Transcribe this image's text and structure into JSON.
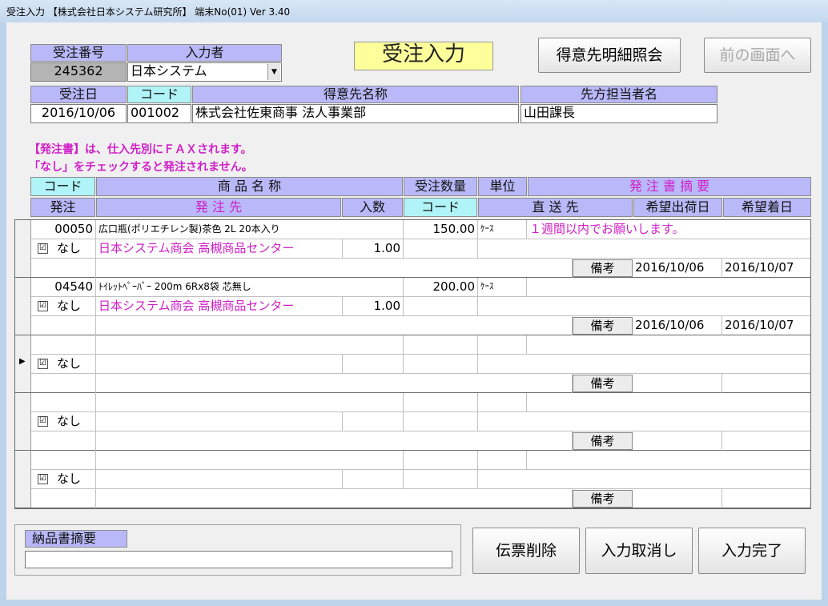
{
  "window": {
    "title": "受注入力 【株式会社日本システム研究所】 端末No(01)  Ver 3.40"
  },
  "header": {
    "order_no_label": "受注番号",
    "order_no": "245362",
    "inputter_label": "入力者",
    "inputter": "日本システム",
    "screen_title": "受注入力",
    "customer_detail_button": "得意先明細照会",
    "prev_screen_button": "前の画面へ",
    "order_date_label": "受注日",
    "order_date": "2016/10/06",
    "code_label": "コード",
    "customer_code": "001002",
    "customer_name_label": "得意先名称",
    "customer_name": "株式会社佐東商事 法人事業部",
    "contact_label": "先方担当者名",
    "contact": "山田課長"
  },
  "notes": {
    "line1": "【発注書】は、仕入先別にＦＡＸされます。",
    "line2": "「なし」をチェックすると発注されません。"
  },
  "grid_headers": {
    "code": "コード",
    "product_name": "商 品 名 称",
    "order_qty": "受注数量",
    "unit": "単位",
    "po_summary": "発 注 書 摘 要",
    "order": "発注",
    "supplier": "発 注 先",
    "pack_qty": "入数",
    "code2": "コード",
    "direct_ship": "直 送 先",
    "ship_date": "希望出荷日",
    "arrival_date": "希望着日"
  },
  "rows": [
    {
      "code": "00050",
      "product": "広口瓶(ポリエチレン製)茶色 2L 20本入り",
      "qty": "150.00",
      "unit": "ｹｰｽ",
      "summary": "１週間以内でお願いします。",
      "nashi": "なし",
      "supplier": "日本システム商会 高槻商品センター",
      "pack": "1.00",
      "remarks": "備考",
      "ship_date": "2016/10/06",
      "arrival_date": "2016/10/07"
    },
    {
      "code": "04540",
      "product": "ﾄｲﾚｯﾄﾍﾟｰﾊﾟｰ 200m 6Rx8袋 芯無し",
      "qty": "200.00",
      "unit": "ｹｰｽ",
      "summary": "",
      "nashi": "なし",
      "supplier": "日本システム商会 高槻商品センター",
      "pack": "1.00",
      "remarks": "備考",
      "ship_date": "2016/10/06",
      "arrival_date": "2016/10/07"
    },
    {
      "code": "",
      "product": "",
      "qty": "",
      "unit": "",
      "summary": "",
      "nashi": "なし",
      "supplier": "",
      "pack": "",
      "remarks": "備考",
      "ship_date": "",
      "arrival_date": ""
    },
    {
      "code": "",
      "product": "",
      "qty": "",
      "unit": "",
      "summary": "",
      "nashi": "なし",
      "supplier": "",
      "pack": "",
      "remarks": "備考",
      "ship_date": "",
      "arrival_date": ""
    },
    {
      "code": "",
      "product": "",
      "qty": "",
      "unit": "",
      "summary": "",
      "nashi": "なし",
      "supplier": "",
      "pack": "",
      "remarks": "備考",
      "ship_date": "",
      "arrival_date": ""
    }
  ],
  "current_row_marker": "▶",
  "checkbox_glyph": "☑",
  "footer": {
    "delivery_note_label": "納品書摘要",
    "delivery_note": "",
    "delete_button": "伝票削除",
    "cancel_button": "入力取消し",
    "complete_button": "入力完了"
  }
}
